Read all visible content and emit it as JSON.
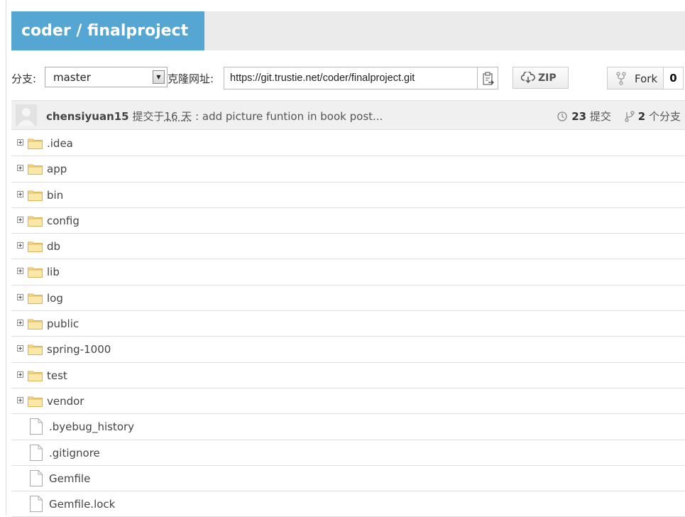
{
  "repo": {
    "title": "coder / finalproject"
  },
  "toolbar": {
    "branch_label": "分支:",
    "branch_value": "master",
    "clone_label": "克隆网址:",
    "clone_url": "https://git.trustie.net/coder/finalproject.git",
    "zip_label": "ZIP",
    "fork_label": "Fork",
    "fork_count": "0"
  },
  "commit": {
    "author": "chensiyuan15",
    "submitted_prefix": "提交于",
    "days": "16 天",
    "message": ": add picture funtion in book post...",
    "commit_count": "23",
    "commit_label": "提交",
    "branch_count": "2",
    "branch_label": "个分支"
  },
  "files": [
    {
      "name": ".idea",
      "type": "folder"
    },
    {
      "name": "app",
      "type": "folder"
    },
    {
      "name": "bin",
      "type": "folder"
    },
    {
      "name": "config",
      "type": "folder"
    },
    {
      "name": "db",
      "type": "folder"
    },
    {
      "name": "lib",
      "type": "folder"
    },
    {
      "name": "log",
      "type": "folder"
    },
    {
      "name": "public",
      "type": "folder"
    },
    {
      "name": "spring-1000",
      "type": "folder"
    },
    {
      "name": "test",
      "type": "folder"
    },
    {
      "name": "vendor",
      "type": "folder"
    },
    {
      "name": ".byebug_history",
      "type": "file"
    },
    {
      "name": ".gitignore",
      "type": "file"
    },
    {
      "name": "Gemfile",
      "type": "file"
    },
    {
      "name": "Gemfile.lock",
      "type": "file"
    }
  ],
  "colors": {
    "title_bg": "#55a6d2",
    "folder": "#f4d27a"
  }
}
